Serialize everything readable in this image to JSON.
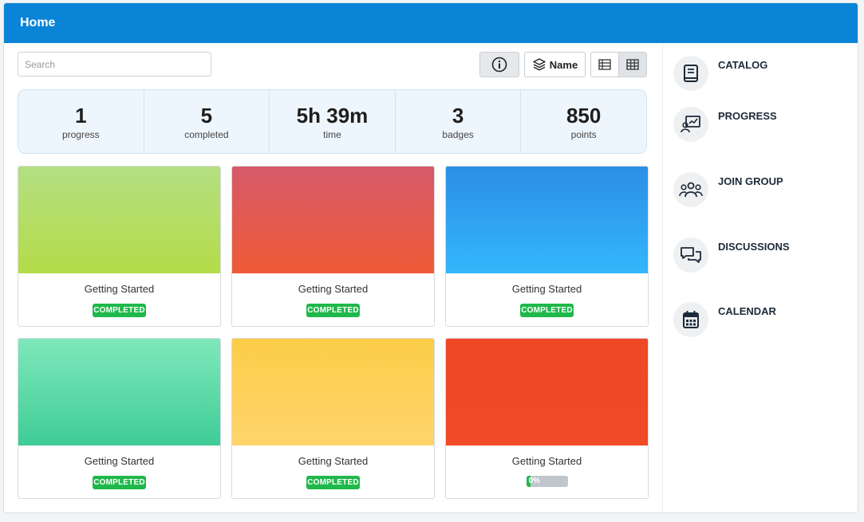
{
  "header": {
    "title": "Home"
  },
  "toolbar": {
    "search_placeholder": "Search",
    "sort_label": "Name"
  },
  "stats": [
    {
      "value": "1",
      "label": "progress"
    },
    {
      "value": "5",
      "label": "completed"
    },
    {
      "value": "5h 39m",
      "label": "time"
    },
    {
      "value": "3",
      "label": "badges"
    },
    {
      "value": "850",
      "label": "points"
    }
  ],
  "cards": [
    {
      "title": "Getting Started",
      "status": "COMPLETED",
      "gradient": [
        "#b3df82",
        "#b5dc48"
      ]
    },
    {
      "title": "Getting Started",
      "status": "COMPLETED",
      "gradient": [
        "#d65a6a",
        "#ef5a36"
      ]
    },
    {
      "title": "Getting Started",
      "status": "COMPLETED",
      "gradient": [
        "#2c8ee6",
        "#33b6fb"
      ]
    },
    {
      "title": "Getting Started",
      "status": "COMPLETED",
      "gradient": [
        "#7fe8bb",
        "#3fcc96"
      ]
    },
    {
      "title": "Getting Started",
      "status": "COMPLETED",
      "gradient": [
        "#fdcd48",
        "#fed46c"
      ]
    },
    {
      "title": "Getting Started",
      "progress_text": "0%",
      "progress_value": 0,
      "gradient": [
        "#ee4826",
        "#f04a27"
      ]
    }
  ],
  "sidebar": {
    "items": [
      {
        "label": "CATALOG",
        "icon": "book-icon"
      },
      {
        "label": "PROGRESS",
        "icon": "presentation-chart-icon"
      },
      {
        "label": "JOIN GROUP",
        "icon": "group-icon"
      },
      {
        "label": "DISCUSSIONS",
        "icon": "chat-bubbles-icon"
      },
      {
        "label": "CALENDAR",
        "icon": "calendar-icon"
      }
    ]
  },
  "colors": {
    "topbar": "#0a84d6",
    "completed_badge": "#1fb84a",
    "icon": "#1c2a3a"
  }
}
